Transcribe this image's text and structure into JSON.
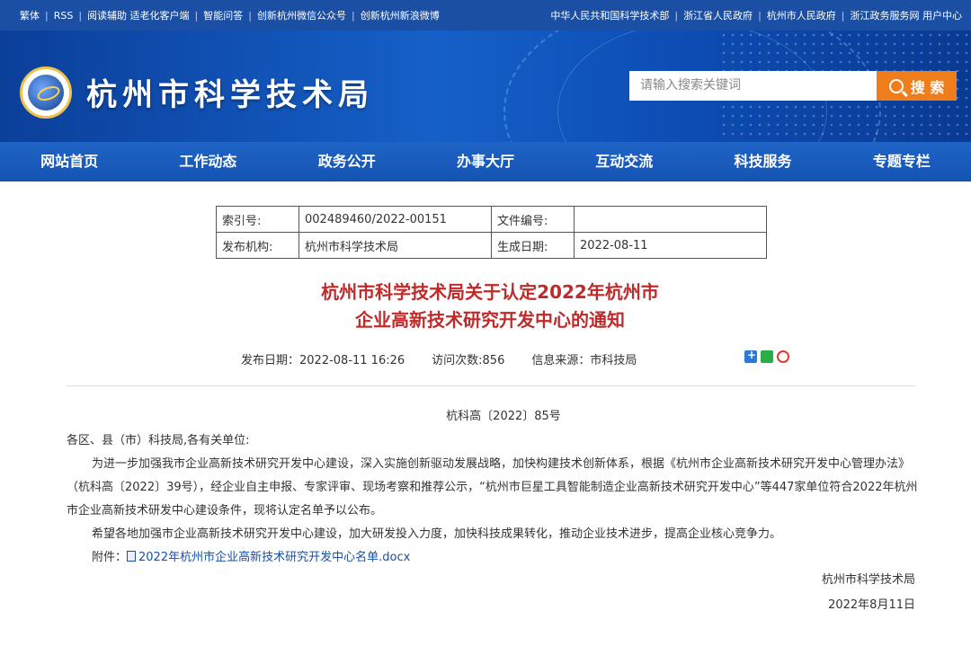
{
  "topbar": {
    "left": [
      "繁体",
      "RSS",
      "阅读辅助 适老化客户端",
      "智能问答",
      "创新杭州微信公众号",
      "创新杭州新浪微博"
    ],
    "right": [
      "中华人民共和国科学技术部",
      "浙江省人民政府",
      "杭州市人民政府",
      "浙江政务服务网 用户中心"
    ]
  },
  "header": {
    "title": "杭州市科学技术局"
  },
  "search": {
    "placeholder": "请输入搜索关键词",
    "button": "搜 索"
  },
  "nav": [
    "网站首页",
    "工作动态",
    "政务公开",
    "办事大厅",
    "互动交流",
    "科技服务",
    "专题专栏"
  ],
  "meta": {
    "index_label": "索引号:",
    "index_value": "002489460/2022-00151",
    "docnum_label": "文件编号:",
    "docnum_value": "",
    "org_label": "发布机构:",
    "org_value": "杭州市科学技术局",
    "date_label": "生成日期:",
    "date_value": "2022-08-11"
  },
  "article": {
    "title_line1": "杭州市科学技术局关于认定2022年杭州市",
    "title_line2": "企业高新技术研究开发中心的通知",
    "publish": "发布日期：2022-08-11 16:26",
    "visits": "访问次数:856",
    "source": "信息来源：市科技局",
    "doc_number": "杭科高〔2022〕85号",
    "salutation": "各区、县（市）科技局,各有关单位:",
    "para1": "为进一步加强我市企业高新技术研究开发中心建设，深入实施创新驱动发展战略，加快构建技术创新体系，根据《杭州市企业高新技术研究开发中心管理办法》（杭科高〔2022〕39号），经企业自主申报、专家评审、现场考察和推荐公示，“杭州市巨星工具智能制造企业高新技术研究开发中心”等447家单位符合2022年杭州市企业高新技术研发中心建设条件，现将认定名单予以公布。",
    "para2": "希望各地加强市企业高新技术研究开发中心建设，加大研发投入力度，加快科技成果转化，推动企业技术进步，提高企业核心竞争力。",
    "attach_label": "附件：",
    "attach_file": "2022年杭州市企业高新技术研究开发中心名单.docx",
    "signer": "杭州市科学技术局",
    "sign_date": "2022年8月11日"
  },
  "colors": {
    "brand_blue": "#1a4fa3",
    "title_red": "#c02a2a",
    "search_orange": "#f07d1c"
  }
}
